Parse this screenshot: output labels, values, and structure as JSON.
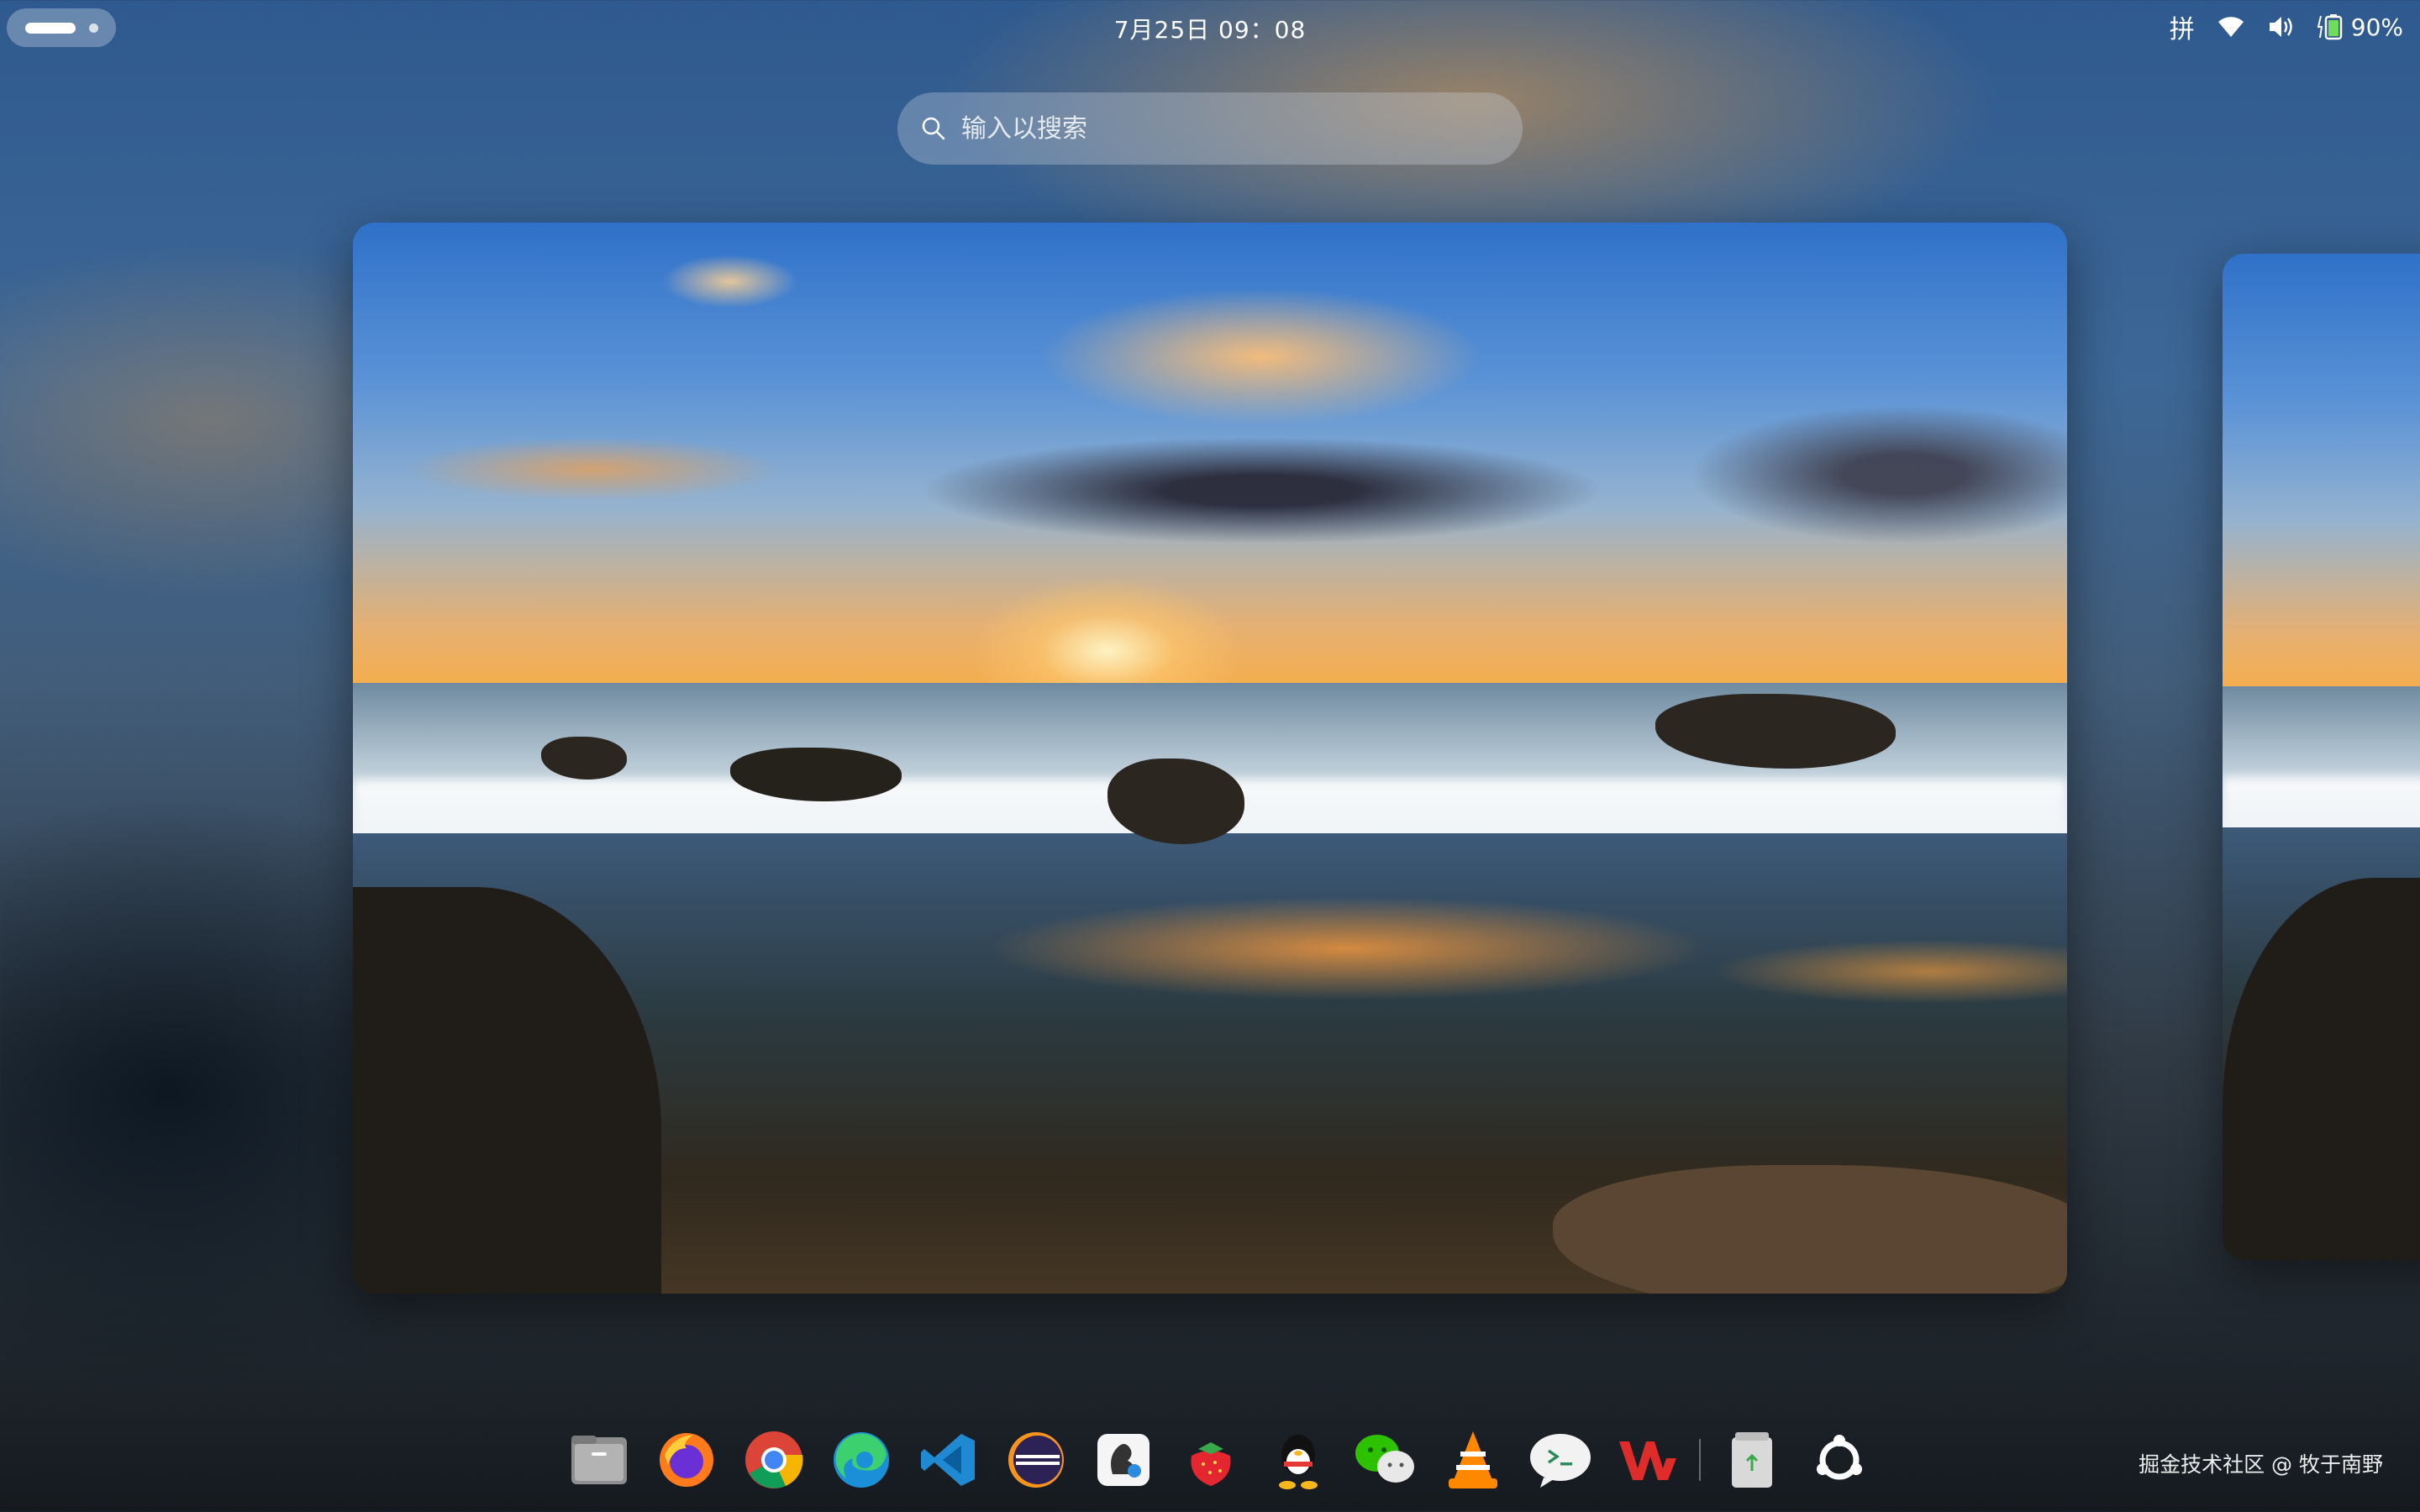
{
  "topbar": {
    "clock": "7月25日  09：08",
    "ime_label": "拼",
    "battery_percent": "90%",
    "icons": [
      "activities-pill",
      "ime-indicator",
      "wifi-icon",
      "volume-icon",
      "battery-icon"
    ]
  },
  "search": {
    "placeholder": "输入以搜索",
    "icon": "search-icon"
  },
  "workspaces": {
    "current": "main",
    "count_visible": 2
  },
  "dock": {
    "apps": [
      {
        "name": "Files",
        "icon": "files-icon"
      },
      {
        "name": "Firefox",
        "icon": "firefox-icon"
      },
      {
        "name": "Chrome",
        "icon": "chrome-icon"
      },
      {
        "name": "Edge",
        "icon": "edge-icon"
      },
      {
        "name": "Visual Studio Code",
        "icon": "vscode-icon"
      },
      {
        "name": "Eclipse",
        "icon": "eclipse-icon"
      },
      {
        "name": "Squirrel",
        "icon": "squirrel-icon"
      },
      {
        "name": "Strawberry",
        "icon": "strawberry-icon"
      },
      {
        "name": "QQ",
        "icon": "qq-icon"
      },
      {
        "name": "WeChat",
        "icon": "wechat-icon"
      },
      {
        "name": "VLC",
        "icon": "vlc-icon"
      },
      {
        "name": "Terminal",
        "icon": "terminal-icon"
      },
      {
        "name": "WPS",
        "icon": "wps-icon"
      },
      {
        "name": "Trash",
        "icon": "trash-icon"
      },
      {
        "name": "Show Apps",
        "icon": "ubuntu-apps-icon"
      }
    ]
  },
  "watermark": "掘金技术社区 @ 牧于南野",
  "colors": {
    "accent": "#ffffff",
    "search_bg": "#cdd7e4",
    "battery_green": "#6fdc5a"
  }
}
